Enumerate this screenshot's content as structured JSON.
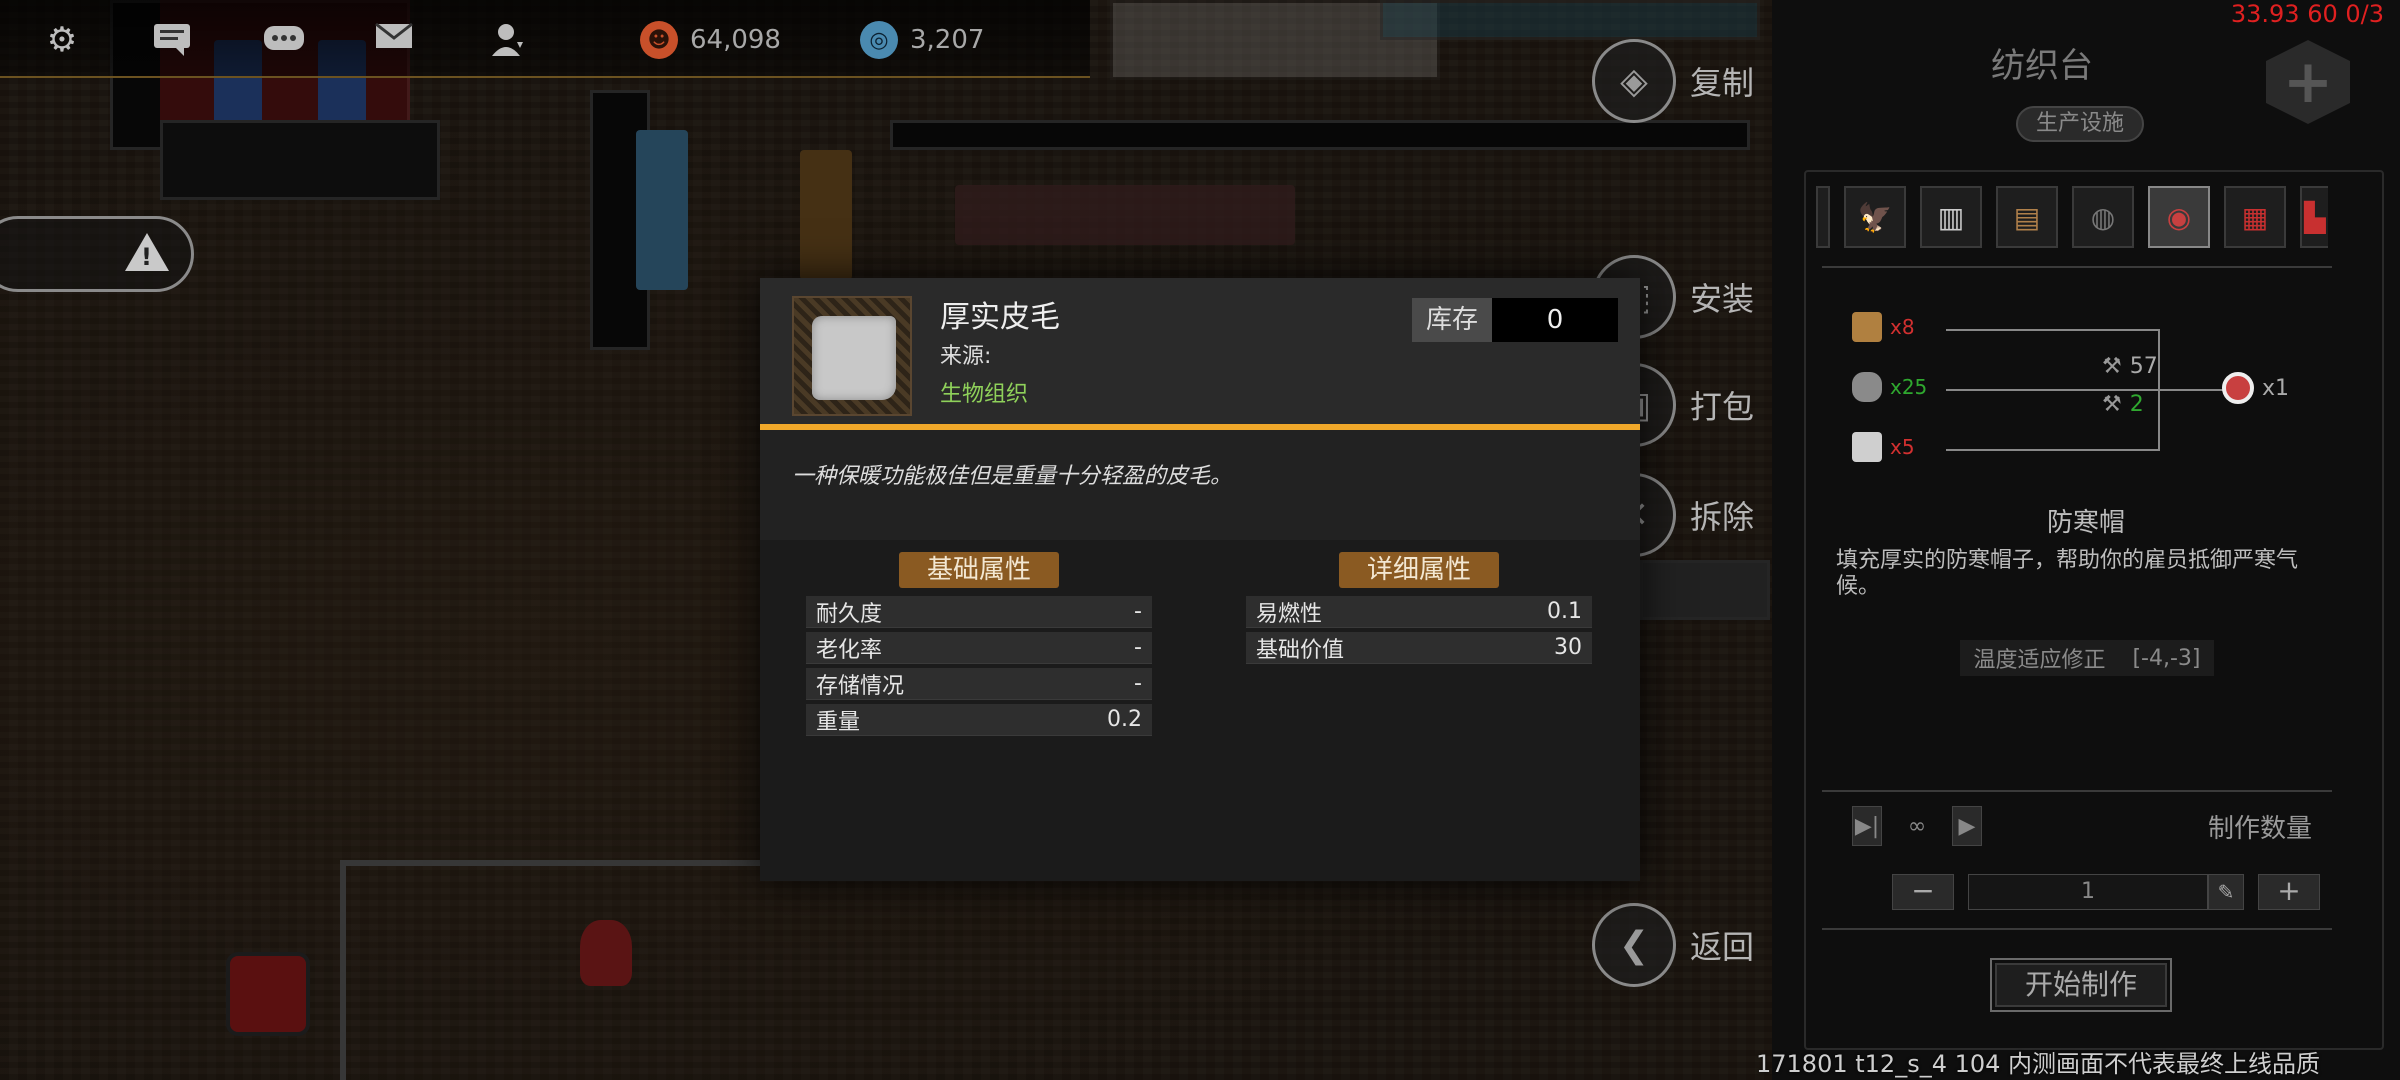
{
  "hud": {
    "resource1_value": "64,098",
    "resource2_value": "3,207",
    "icons": [
      "gear-icon",
      "chat-icon",
      "message-icon",
      "mail-icon",
      "person-icon"
    ]
  },
  "actions": {
    "copy": "复制",
    "install": "安装",
    "pack": "打包",
    "demolish": "拆除",
    "back": "返回"
  },
  "item": {
    "name": "厚实皮毛",
    "source_label": "来源:",
    "source_value": "生物组织",
    "stock_label": "库存",
    "stock_value": "0",
    "description": "一种保暖功能极佳但是重量十分轻盈的皮毛。",
    "basic_header": "基础属性",
    "detail_header": "详细属性",
    "basic_attrs": [
      {
        "name": "耐久度",
        "value": "-"
      },
      {
        "name": "老化率",
        "value": "-"
      },
      {
        "name": "存储情况",
        "value": "-"
      },
      {
        "name": "重量",
        "value": "0.2"
      }
    ],
    "detail_attrs": [
      {
        "name": "易燃性",
        "value": "0.1"
      },
      {
        "name": "基础价值",
        "value": "30"
      }
    ]
  },
  "panel": {
    "title": "纺织台",
    "tag": "生产设施",
    "ingredients": [
      {
        "qty": "x8",
        "color": "#d23030"
      },
      {
        "qty": "x25",
        "color": "#2fa82f"
      },
      {
        "qty": "x5",
        "color": "#d23030"
      }
    ],
    "tool1_value": "57",
    "tool2_value": "2",
    "output_qty": "x1",
    "product_name": "防寒帽",
    "product_desc": "填充厚实的防寒帽子，帮助你的雇员抵御严寒气候。",
    "stat_label": "温度适应修正",
    "stat_value": "[-4,-3]",
    "qty_label": "制作数量",
    "qty_value": "1",
    "minus": "−",
    "plus": "+",
    "start_label": "开始制作"
  },
  "debug": {
    "top": "33.93 60 0/3",
    "bottom": "171801 t12_s_4 104 内测画面不代表最终上线品质"
  },
  "colors": {
    "accent_orange": "#f0a82a",
    "attr_header": "#8a5a22",
    "source_green": "#8fd15a",
    "debug_red": "#e02020"
  }
}
